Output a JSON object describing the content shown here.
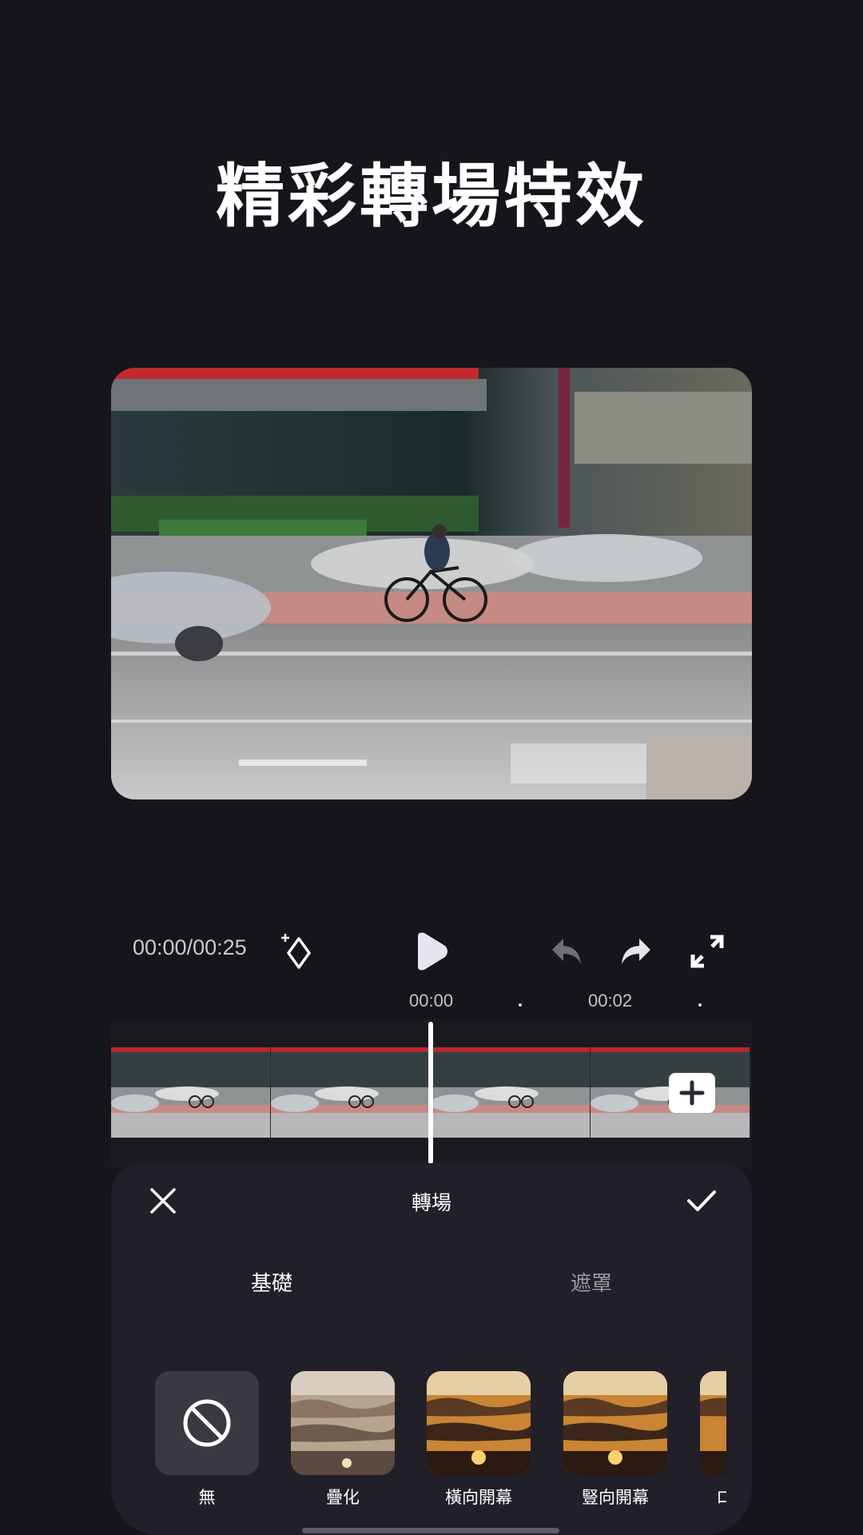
{
  "promo": {
    "title": "精彩轉場特效"
  },
  "player": {
    "timecode": "00:00/00:25",
    "ruler_ticks": [
      "00:00",
      "00:02"
    ]
  },
  "icons": {
    "keyframe": "keyframe-add-icon",
    "play": "play-icon",
    "undo": "undo-icon",
    "redo": "redo-icon",
    "fullscreen": "fullscreen-icon",
    "add_clip": "add-icon",
    "close": "close-icon",
    "confirm": "check-icon",
    "none": "prohibited-icon"
  },
  "sheet": {
    "title": "轉場",
    "tabs": [
      {
        "label": "基礎",
        "active": true
      },
      {
        "label": "遮罩",
        "active": false
      }
    ],
    "effects": [
      {
        "label": "無"
      },
      {
        "label": "疊化"
      },
      {
        "label": "橫向開幕"
      },
      {
        "label": "豎向開幕"
      },
      {
        "label": "ロ"
      }
    ]
  },
  "colors": {
    "background": "#16151c",
    "sheet": "#212029",
    "accent": "#ffffff",
    "inactive_tab": "#9a99a3"
  }
}
